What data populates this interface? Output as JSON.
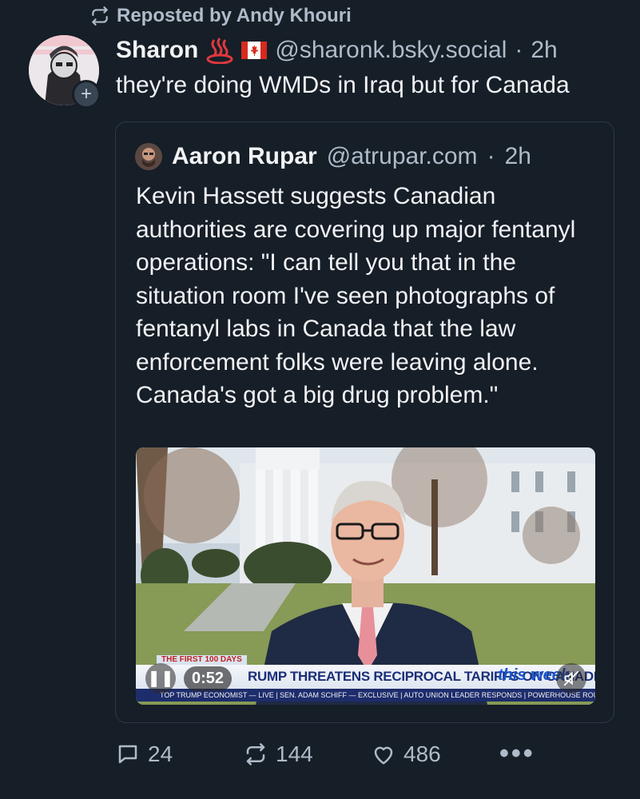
{
  "repost": {
    "label": "Reposted by Andy Khouri"
  },
  "post": {
    "display_name": "Sharon",
    "handle": "@sharonk.bsky.social",
    "separator": "·",
    "time": "2h",
    "text": "they're doing WMDs in Iraq but for Canada",
    "emoji": [
      "hot-springs-icon",
      "canada-flag-icon"
    ]
  },
  "quote": {
    "display_name": "Aaron Rupar",
    "handle": "@atrupar.com",
    "separator": "·",
    "time": "2h",
    "text": "Kevin Hassett suggests Canadian authorities are covering up major fentanyl operations: \"I can tell you that in the situation room I've seen photographs of fentanyl labs in Canada that the law enforcement folks were leaving alone. Canada's got a big drug problem.\"",
    "video": {
      "banner_top": "THE FIRST 100 DAYS",
      "banner_main": "RUMP THREATENS RECIPROCAL TARIFFS ON CANADIAN LUMBER, DAIRY",
      "brand": "this week",
      "ticker": "TOP TRUMP ECONOMIST — LIVE | SEN. ADAM SCHIFF — EXCLUSIVE | AUTO UNION LEADER RESPONDS | POWERHOUSE ROUNDTABLE",
      "duration": "0:52"
    }
  },
  "actions": {
    "replies": "24",
    "reposts": "144",
    "likes": "486",
    "more": "•••"
  },
  "colors": {
    "background": "#161e27",
    "muted": "#aebbc9",
    "text": "#f1f3f5",
    "border": "#2e3947"
  }
}
